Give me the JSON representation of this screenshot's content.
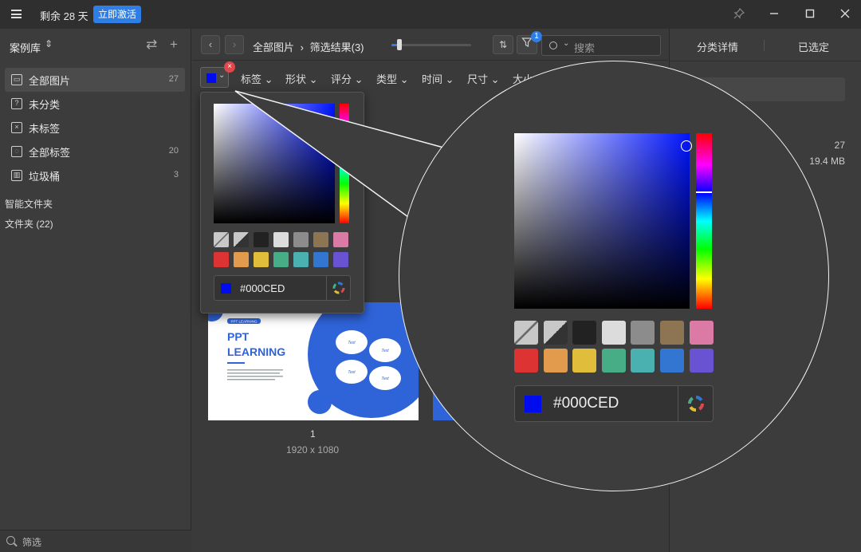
{
  "titlebar": {
    "trial_text": "剩余 28 天",
    "activate_label": "立即激活"
  },
  "sidebar": {
    "library_title": "案例库",
    "items": [
      {
        "label": "全部图片",
        "count": "27",
        "icon": "all-images-icon"
      },
      {
        "label": "未分类",
        "count": "",
        "icon": "unclassified-icon"
      },
      {
        "label": "未标签",
        "count": "",
        "icon": "untagged-icon"
      },
      {
        "label": "全部标签",
        "count": "20",
        "icon": "all-tags-icon"
      },
      {
        "label": "垃圾桶",
        "count": "3",
        "icon": "trash-icon"
      }
    ],
    "smart_folder": "智能文件夹",
    "folders": "文件夹 (22)",
    "filter_label": "筛选"
  },
  "header": {
    "breadcrumb_root": "全部图片",
    "breadcrumb_sep": "›",
    "breadcrumb_current": "筛选结果(3)",
    "zoom_level": 0.1,
    "filter_badge": "1",
    "search_placeholder": "搜索"
  },
  "filters": {
    "selected_color": "#000CED",
    "items": [
      "标签",
      "形状",
      "评分",
      "类型",
      "时间",
      "尺寸",
      "大小"
    ]
  },
  "color_picker": {
    "hex_value": "#000CED",
    "swatches_row1": [
      "transparent",
      "half",
      "#222222",
      "#dcdcdc",
      "#8c8c8c",
      "#8d7453",
      "#dc7aa6"
    ],
    "swatches_row2": [
      "#dd3333",
      "#e29a4c",
      "#e0bd3a",
      "#46ad86",
      "#4ab0b0",
      "#3276d1",
      "#6a53d2"
    ]
  },
  "content": {
    "thumb": {
      "badge": "PPT LEARNING",
      "title_line1": "PPT",
      "title_line2": "LEARNING",
      "petal_text": "Text",
      "name": "1",
      "size": "1920 x 1080"
    }
  },
  "right_panel": {
    "tab_details": "分类详情",
    "tab_selected": "已选定",
    "search_placeholder": "图片",
    "count": "27",
    "file_size": "19.4 MB"
  }
}
